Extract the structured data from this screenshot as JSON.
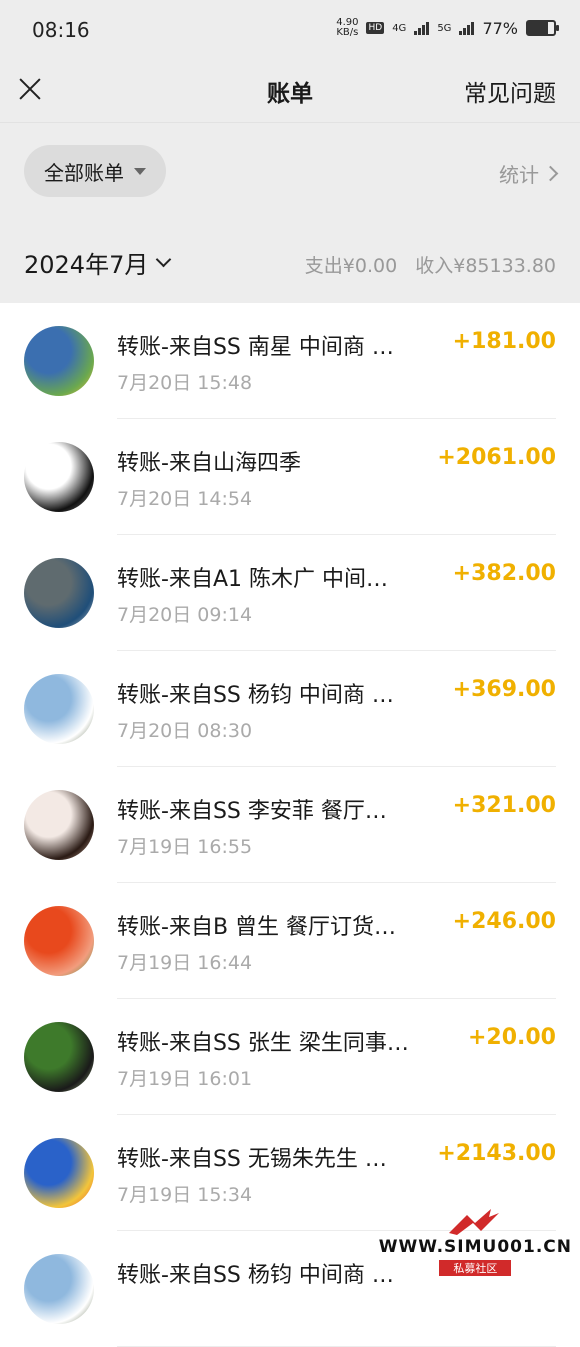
{
  "status": {
    "time": "08:16",
    "speed": "4.90",
    "speed_unit": "KB/s",
    "battery": "77%",
    "battery_level": 0.77,
    "net1": "4G",
    "net2": "5G",
    "hd": "HD"
  },
  "nav": {
    "title": "账单",
    "faq": "常见问题"
  },
  "filter": {
    "label": "全部账单",
    "stats": "统计"
  },
  "month": {
    "label": "2024年7月",
    "expense": "支出¥0.00",
    "income": "收入¥85133.80"
  },
  "transactions": [
    {
      "desc": "转账-来自SS 南星 中间商 …",
      "date": "7月20日 15:48",
      "amount": "+181.00",
      "avatar_colors": [
        "#3b6fb0",
        "#6aa84f",
        "#f1c232"
      ]
    },
    {
      "desc": "转账-来自山海四季",
      "date": "7月20日 14:54",
      "amount": "+2061.00",
      "avatar_colors": [
        "#ffffff",
        "#111111",
        "#888888"
      ]
    },
    {
      "desc": "转账-来自A1 陈木广 中间…",
      "date": "7月20日 09:14",
      "amount": "+382.00",
      "avatar_colors": [
        "#5f6b6f",
        "#1f4e79",
        "#c9c9c9"
      ]
    },
    {
      "desc": "转账-来自SS 杨钧 中间商 …",
      "date": "7月20日 08:30",
      "amount": "+369.00",
      "avatar_colors": [
        "#8fb8de",
        "#ffffff",
        "#4a5a3a"
      ]
    },
    {
      "desc": "转账-来自SS 李安菲 餐厅…",
      "date": "7月19日 16:55",
      "amount": "+321.00",
      "avatar_colors": [
        "#f3e9e4",
        "#2a1a14",
        "#d9b9a6"
      ]
    },
    {
      "desc": "转账-来自B 曾生 餐厅订货…",
      "date": "7月19日 16:44",
      "amount": "+246.00",
      "avatar_colors": [
        "#e8491d",
        "#f29d7e",
        "#3c8f3a"
      ]
    },
    {
      "desc": "转账-来自SS 张生 梁生同事…",
      "date": "7月19日 16:01",
      "amount": "+20.00",
      "avatar_colors": [
        "#3e7a2b",
        "#1a1a1a",
        "#a7c48a"
      ]
    },
    {
      "desc": "转账-来自SS 无锡朱先生 …",
      "date": "7月19日 15:34",
      "amount": "+2143.00",
      "avatar_colors": [
        "#2a62c9",
        "#f3c53a",
        "#e84b2a"
      ]
    },
    {
      "desc": "转账-来自SS 杨钧 中间商 …",
      "date": "",
      "amount": "",
      "avatar_colors": [
        "#8fb8de",
        "#ffffff",
        "#4a5a3a"
      ]
    }
  ],
  "watermark": {
    "site": "WWW.SIMU001.CN",
    "sub": "私募社区"
  }
}
